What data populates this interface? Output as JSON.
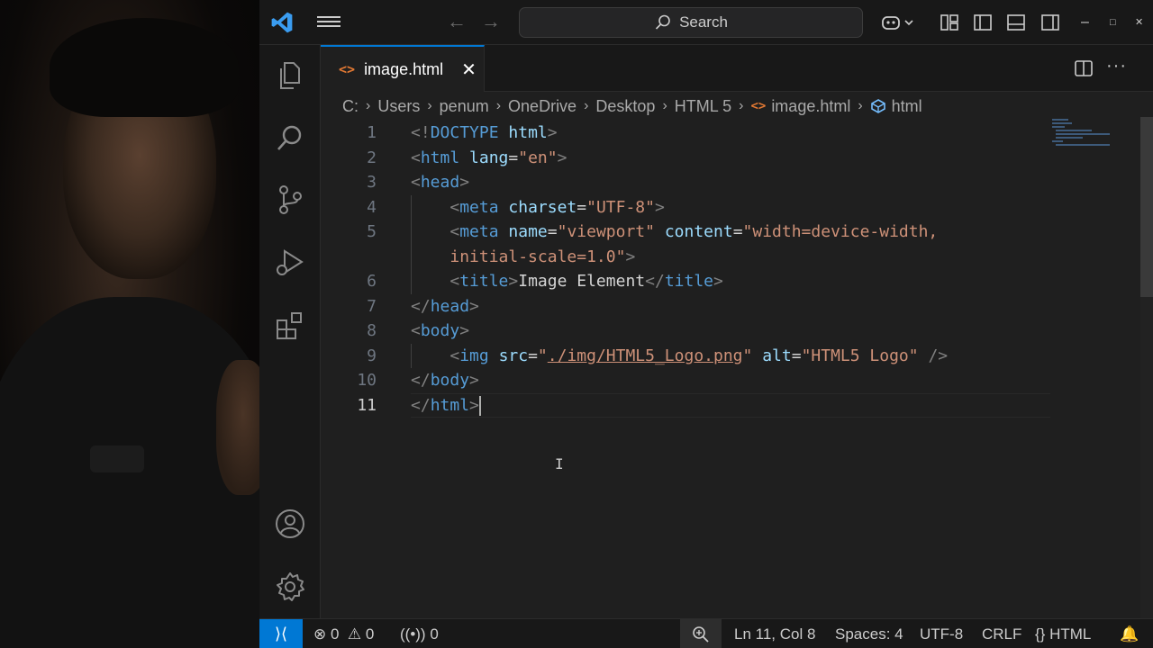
{
  "app": {
    "search_placeholder": "Search"
  },
  "tabs": [
    {
      "label": "image.html",
      "icon": "html-file-icon"
    }
  ],
  "breadcrumb": [
    "C:",
    "Users",
    "penum",
    "OneDrive",
    "Desktop",
    "HTML 5",
    "image.html",
    "html"
  ],
  "code_lines": [
    {
      "num": "1",
      "tokens": [
        [
          "p",
          "<!"
        ],
        [
          "d",
          "DOCTYPE"
        ],
        [
          "x",
          " "
        ],
        [
          "a",
          "html"
        ],
        [
          "p",
          ">"
        ]
      ]
    },
    {
      "num": "2",
      "tokens": [
        [
          "p",
          "<"
        ],
        [
          "t",
          "html"
        ],
        [
          "x",
          " "
        ],
        [
          "a",
          "lang"
        ],
        [
          "x",
          "="
        ],
        [
          "s",
          "\"en\""
        ],
        [
          "p",
          ">"
        ]
      ]
    },
    {
      "num": "3",
      "tokens": [
        [
          "p",
          "<"
        ],
        [
          "t",
          "head"
        ],
        [
          "p",
          ">"
        ]
      ]
    },
    {
      "num": "4",
      "indent": 1,
      "tokens": [
        [
          "p",
          "<"
        ],
        [
          "t",
          "meta"
        ],
        [
          "x",
          " "
        ],
        [
          "a",
          "charset"
        ],
        [
          "x",
          "="
        ],
        [
          "s",
          "\"UTF-8\""
        ],
        [
          "p",
          ">"
        ]
      ]
    },
    {
      "num": "5",
      "indent": 1,
      "tokens": [
        [
          "p",
          "<"
        ],
        [
          "t",
          "meta"
        ],
        [
          "x",
          " "
        ],
        [
          "a",
          "name"
        ],
        [
          "x",
          "="
        ],
        [
          "s",
          "\"viewport\""
        ],
        [
          "x",
          " "
        ],
        [
          "a",
          "content"
        ],
        [
          "x",
          "="
        ],
        [
          "s",
          "\"width=device-width,"
        ]
      ]
    },
    {
      "num": "",
      "indent": 1,
      "tokens": [
        [
          "s",
          "initial-scale=1.0\""
        ],
        [
          "p",
          ">"
        ]
      ]
    },
    {
      "num": "6",
      "indent": 1,
      "tokens": [
        [
          "p",
          "<"
        ],
        [
          "t",
          "title"
        ],
        [
          "p",
          ">"
        ],
        [
          "x",
          "Image Element"
        ],
        [
          "p",
          "</"
        ],
        [
          "t",
          "title"
        ],
        [
          "p",
          ">"
        ]
      ]
    },
    {
      "num": "7",
      "tokens": [
        [
          "p",
          "</"
        ],
        [
          "t",
          "head"
        ],
        [
          "p",
          ">"
        ]
      ]
    },
    {
      "num": "8",
      "tokens": [
        [
          "p",
          "<"
        ],
        [
          "t",
          "body"
        ],
        [
          "p",
          ">"
        ]
      ]
    },
    {
      "num": "9",
      "indent": 1,
      "tokens": [
        [
          "p",
          "<"
        ],
        [
          "t",
          "img"
        ],
        [
          "x",
          " "
        ],
        [
          "a",
          "src"
        ],
        [
          "x",
          "="
        ],
        [
          "s",
          "\""
        ],
        [
          "su",
          "./img/HTML5_Logo.png"
        ],
        [
          "s",
          "\""
        ],
        [
          "x",
          " "
        ],
        [
          "a",
          "alt"
        ],
        [
          "x",
          "="
        ],
        [
          "s",
          "\"HTML5 Logo\""
        ],
        [
          "x",
          " "
        ],
        [
          "p",
          "/>"
        ]
      ]
    },
    {
      "num": "10",
      "tokens": [
        [
          "p",
          "</"
        ],
        [
          "t",
          "body"
        ],
        [
          "p",
          ">"
        ]
      ]
    },
    {
      "num": "11",
      "current": true,
      "tokens": [
        [
          "p",
          "</"
        ],
        [
          "t",
          "html"
        ],
        [
          "p",
          ">"
        ]
      ]
    }
  ],
  "status": {
    "errors": "0",
    "warnings": "0",
    "ports": "0",
    "position": "Ln 11, Col 8",
    "spaces": "Spaces: 4",
    "encoding": "UTF-8",
    "eol": "CRLF",
    "language": "HTML"
  },
  "colors": {
    "accent": "#0078d4",
    "tag": "#569cd6",
    "attr": "#9cdcfe",
    "string": "#ce9178",
    "html_icon": "#e37933"
  }
}
